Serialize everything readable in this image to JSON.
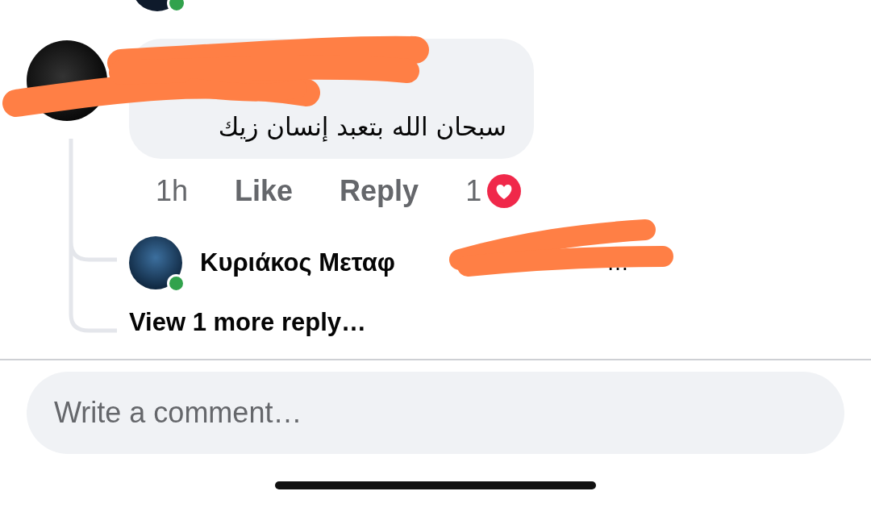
{
  "comment": {
    "text": "سبحان الله بتعبد إنسان زيك",
    "time": "1h",
    "actions": [
      "Like",
      "Reply"
    ],
    "reaction_count": "1"
  },
  "reply": {
    "author": "Κυριάκος Μεταφ",
    "ellipsis": "…",
    "online": true
  },
  "view_more": "View 1 more reply…",
  "composer": {
    "placeholder": "Write a comment…"
  }
}
